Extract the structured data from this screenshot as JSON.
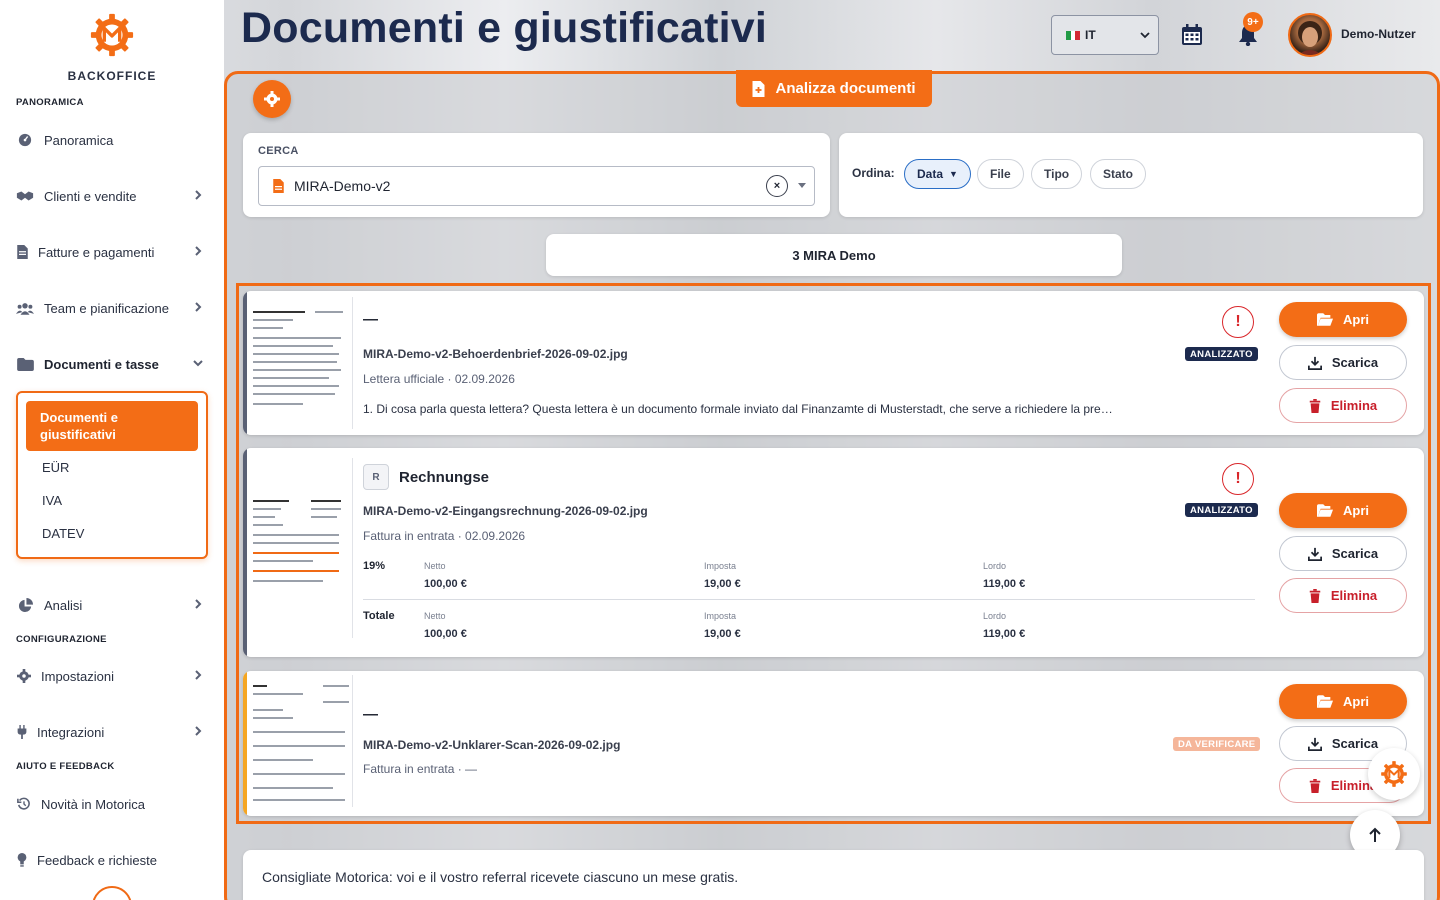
{
  "brand": {
    "name": "BACKOFFICE",
    "accent": "#f36d16",
    "navy": "#1c2a4e"
  },
  "sidebar": {
    "sections": {
      "overview": "PANORAMICA",
      "config": "CONFIGURAZIONE",
      "help": "AIUTO E FEEDBACK"
    },
    "items": [
      {
        "label": "Panoramica",
        "icon": "dashboard-icon"
      },
      {
        "label": "Clienti e vendite",
        "icon": "handshake-icon"
      },
      {
        "label": "Fatture e pagamenti",
        "icon": "invoice-icon"
      },
      {
        "label": "Team e pianificazione",
        "icon": "team-icon"
      },
      {
        "label": "Documenti e tasse",
        "icon": "folder-icon"
      },
      {
        "label": "Analisi",
        "icon": "pie-chart-icon"
      },
      {
        "label": "Impostazioni",
        "icon": "gear-icon"
      },
      {
        "label": "Integrazioni",
        "icon": "plug-icon"
      },
      {
        "label": "Novità in Motorica",
        "icon": "history-icon"
      },
      {
        "label": "Feedback e richieste",
        "icon": "lightbulb-icon"
      }
    ],
    "submenu": [
      "Documenti e giustificativi",
      "EÜR",
      "IVA",
      "DATEV"
    ]
  },
  "header": {
    "title": "Documenti e giustificativi",
    "language": "IT",
    "notifications": "9+",
    "user": "Demo-Nutzer"
  },
  "toolbar": {
    "analyze_label": "Analizza documenti"
  },
  "search": {
    "label": "CERCA",
    "value": "MIRA-Demo-v2",
    "clear": "×"
  },
  "sort": {
    "label": "Ordina:",
    "options": [
      {
        "label": "Data",
        "active": true,
        "arrow": "▼"
      },
      {
        "label": "File",
        "active": false
      },
      {
        "label": "Tipo",
        "active": false
      },
      {
        "label": "Stato",
        "active": false
      }
    ]
  },
  "result_count": "3 MIRA Demo",
  "actions": {
    "open": "Apri",
    "download": "Scarica",
    "delete": "Elimina"
  },
  "documents": [
    {
      "title": "—",
      "file": "MIRA-Demo-v2-Behoerdenbrief-2026-09-02.jpg",
      "meta": "Lettera ufficiale · 02.09.2026",
      "status": "ANALIZZATO",
      "warning": "!",
      "description": "1. Di cosa parla questa lettera? Questa lettera è un documento formale inviato dal Finanzamte di Musterstadt, che serve a richiedere la pre…"
    },
    {
      "badge": "R",
      "title": "Rechnungse",
      "file": "MIRA-Demo-v2-Eingangsrechnung-2026-09-02.jpg",
      "meta": "Fattura in entrata · 02.09.2026",
      "status": "ANALIZZATO",
      "warning": "!",
      "tax": {
        "col_labels": [
          "Netto",
          "Imposta",
          "Lordo"
        ],
        "rows": [
          {
            "label": "19%",
            "values": [
              "100,00 €",
              "19,00 €",
              "119,00 €"
            ]
          },
          {
            "label": "Totale",
            "values": [
              "100,00 €",
              "19,00 €",
              "119,00 €"
            ]
          }
        ]
      }
    },
    {
      "title": "—",
      "file": "MIRA-Demo-v2-Unklarer-Scan-2026-09-02.jpg",
      "meta": "Fattura in entrata · —",
      "status": "DA VERIFICARE"
    }
  ],
  "referral": "Consigliate Motorica: voi e il vostro referral ricevete ciascuno un mese gratis."
}
